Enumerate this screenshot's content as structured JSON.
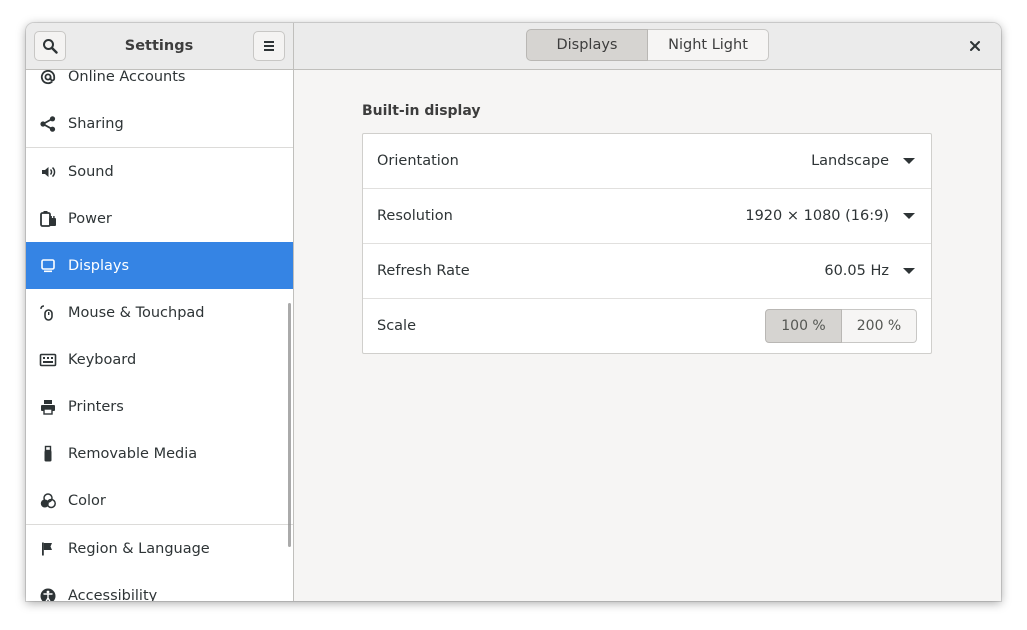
{
  "header": {
    "title": "Settings",
    "search_icon": "search-icon",
    "menu_icon": "hamburger-menu-icon",
    "close_icon": "close-icon",
    "tabs": [
      {
        "label": "Displays",
        "active": true
      },
      {
        "label": "Night Light",
        "active": false
      }
    ]
  },
  "sidebar": {
    "items": [
      {
        "label": "Online Accounts",
        "icon": "at-icon"
      },
      {
        "label": "Sharing",
        "icon": "share-icon"
      },
      {
        "label": "Sound",
        "icon": "speaker-icon"
      },
      {
        "label": "Power",
        "icon": "power-icon"
      },
      {
        "label": "Displays",
        "icon": "display-icon",
        "active": true
      },
      {
        "label": "Mouse & Touchpad",
        "icon": "mouse-icon"
      },
      {
        "label": "Keyboard",
        "icon": "keyboard-icon"
      },
      {
        "label": "Printers",
        "icon": "printer-icon"
      },
      {
        "label": "Removable Media",
        "icon": "usb-icon"
      },
      {
        "label": "Color",
        "icon": "color-icon"
      },
      {
        "label": "Region & Language",
        "icon": "flag-icon"
      },
      {
        "label": "Accessibility",
        "icon": "accessibility-icon"
      }
    ]
  },
  "main": {
    "section_title": "Built-in display",
    "rows": {
      "orientation": {
        "label": "Orientation",
        "value": "Landscape"
      },
      "resolution": {
        "label": "Resolution",
        "value": "1920 × 1080 (16:9)"
      },
      "refresh_rate": {
        "label": "Refresh Rate",
        "value": "60.05 Hz"
      },
      "scale": {
        "label": "Scale",
        "options": [
          "100 %",
          "200 %"
        ],
        "selected": "100 %"
      }
    }
  },
  "colors": {
    "accent": "#3584e4",
    "window_bg": "#f6f5f4",
    "headerbar_bg": "#ebebeb"
  }
}
